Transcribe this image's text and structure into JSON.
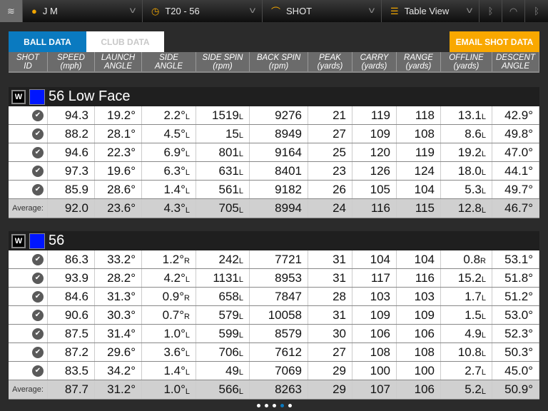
{
  "topbar": {
    "player": "J M",
    "session": "T20 - 56",
    "mode": "SHOT",
    "view": "Table View",
    "icons": [
      "logo-icon",
      "person-icon",
      "clock-icon",
      "shot-arc-icon",
      "list-icon",
      "bluetooth-icon",
      "wifi-icon",
      "bluetooth-signal-icon"
    ]
  },
  "tabs": {
    "ball": "BALL DATA",
    "club": "CLUB DATA"
  },
  "email": "EMAIL SHOT DATA",
  "columns": [
    [
      "SHOT",
      "ID"
    ],
    [
      "SPEED",
      "(mph)"
    ],
    [
      "LAUNCH",
      "ANGLE"
    ],
    [
      "SIDE",
      "ANGLE"
    ],
    [
      "SIDE SPIN",
      "(rpm)"
    ],
    [
      "BACK SPIN",
      "(rpm)"
    ],
    [
      "PEAK",
      "(yards)"
    ],
    [
      "CARRY",
      "(yards)"
    ],
    [
      "RANGE",
      "(yards)"
    ],
    [
      "OFFLINE",
      "(yards)"
    ],
    [
      "DESCENT",
      "ANGLE"
    ]
  ],
  "average_label": "Average:",
  "colors": {
    "accent": "#0a7ac0",
    "email": "#f9a800",
    "club_color": "#0016ff"
  },
  "groups": [
    {
      "badge": "W",
      "name": "56 Low Face",
      "rows": [
        [
          [
            "94.3",
            ""
          ],
          [
            "19.2°",
            ""
          ],
          [
            "2.2°",
            "L"
          ],
          [
            "1519",
            "L"
          ],
          [
            "9276",
            ""
          ],
          [
            "21",
            ""
          ],
          [
            "119",
            ""
          ],
          [
            "118",
            ""
          ],
          [
            "13.1",
            "L"
          ],
          [
            "42.9°",
            ""
          ]
        ],
        [
          [
            "88.2",
            ""
          ],
          [
            "28.1°",
            ""
          ],
          [
            "4.5°",
            "L"
          ],
          [
            "15",
            "L"
          ],
          [
            "8949",
            ""
          ],
          [
            "27",
            ""
          ],
          [
            "109",
            ""
          ],
          [
            "108",
            ""
          ],
          [
            "8.6",
            "L"
          ],
          [
            "49.8°",
            ""
          ]
        ],
        [
          [
            "94.6",
            ""
          ],
          [
            "22.3°",
            ""
          ],
          [
            "6.9°",
            "L"
          ],
          [
            "801",
            "L"
          ],
          [
            "9164",
            ""
          ],
          [
            "25",
            ""
          ],
          [
            "120",
            ""
          ],
          [
            "119",
            ""
          ],
          [
            "19.2",
            "L"
          ],
          [
            "47.0°",
            ""
          ]
        ],
        [
          [
            "97.3",
            ""
          ],
          [
            "19.6°",
            ""
          ],
          [
            "6.3°",
            "L"
          ],
          [
            "631",
            "L"
          ],
          [
            "8401",
            ""
          ],
          [
            "23",
            ""
          ],
          [
            "126",
            ""
          ],
          [
            "124",
            ""
          ],
          [
            "18.0",
            "L"
          ],
          [
            "44.1°",
            ""
          ]
        ],
        [
          [
            "85.9",
            ""
          ],
          [
            "28.6°",
            ""
          ],
          [
            "1.4°",
            "L"
          ],
          [
            "561",
            "L"
          ],
          [
            "9182",
            ""
          ],
          [
            "26",
            ""
          ],
          [
            "105",
            ""
          ],
          [
            "104",
            ""
          ],
          [
            "5.3",
            "L"
          ],
          [
            "49.7°",
            ""
          ]
        ]
      ],
      "average": [
        [
          "92.0",
          ""
        ],
        [
          "23.6°",
          ""
        ],
        [
          "4.3°",
          "L"
        ],
        [
          "705",
          "L"
        ],
        [
          "8994",
          ""
        ],
        [
          "24",
          ""
        ],
        [
          "116",
          ""
        ],
        [
          "115",
          ""
        ],
        [
          "12.8",
          "L"
        ],
        [
          "46.7°",
          ""
        ]
      ]
    },
    {
      "badge": "W",
      "name": "56",
      "rows": [
        [
          [
            "86.3",
            ""
          ],
          [
            "33.2°",
            ""
          ],
          [
            "1.2°",
            "R"
          ],
          [
            "242",
            "L"
          ],
          [
            "7721",
            ""
          ],
          [
            "31",
            ""
          ],
          [
            "104",
            ""
          ],
          [
            "104",
            ""
          ],
          [
            "0.8",
            "R"
          ],
          [
            "53.1°",
            ""
          ]
        ],
        [
          [
            "93.9",
            ""
          ],
          [
            "28.2°",
            ""
          ],
          [
            "4.2°",
            "L"
          ],
          [
            "1131",
            "L"
          ],
          [
            "8953",
            ""
          ],
          [
            "31",
            ""
          ],
          [
            "117",
            ""
          ],
          [
            "116",
            ""
          ],
          [
            "15.2",
            "L"
          ],
          [
            "51.8°",
            ""
          ]
        ],
        [
          [
            "84.6",
            ""
          ],
          [
            "31.3°",
            ""
          ],
          [
            "0.9°",
            "R"
          ],
          [
            "658",
            "L"
          ],
          [
            "7847",
            ""
          ],
          [
            "28",
            ""
          ],
          [
            "103",
            ""
          ],
          [
            "103",
            ""
          ],
          [
            "1.7",
            "L"
          ],
          [
            "51.2°",
            ""
          ]
        ],
        [
          [
            "90.6",
            ""
          ],
          [
            "30.3°",
            ""
          ],
          [
            "0.7°",
            "R"
          ],
          [
            "579",
            "L"
          ],
          [
            "10058",
            ""
          ],
          [
            "31",
            ""
          ],
          [
            "109",
            ""
          ],
          [
            "109",
            ""
          ],
          [
            "1.5",
            "L"
          ],
          [
            "53.0°",
            ""
          ]
        ],
        [
          [
            "87.5",
            ""
          ],
          [
            "31.4°",
            ""
          ],
          [
            "1.0°",
            "L"
          ],
          [
            "599",
            "L"
          ],
          [
            "8579",
            ""
          ],
          [
            "30",
            ""
          ],
          [
            "106",
            ""
          ],
          [
            "106",
            ""
          ],
          [
            "4.9",
            "L"
          ],
          [
            "52.3°",
            ""
          ]
        ],
        [
          [
            "87.2",
            ""
          ],
          [
            "29.6°",
            ""
          ],
          [
            "3.6°",
            "L"
          ],
          [
            "706",
            "L"
          ],
          [
            "7612",
            ""
          ],
          [
            "27",
            ""
          ],
          [
            "108",
            ""
          ],
          [
            "108",
            ""
          ],
          [
            "10.8",
            "L"
          ],
          [
            "50.3°",
            ""
          ]
        ],
        [
          [
            "83.5",
            ""
          ],
          [
            "34.2°",
            ""
          ],
          [
            "1.4°",
            "L"
          ],
          [
            "49",
            "L"
          ],
          [
            "7069",
            ""
          ],
          [
            "29",
            ""
          ],
          [
            "100",
            ""
          ],
          [
            "100",
            ""
          ],
          [
            "2.7",
            "L"
          ],
          [
            "45.0°",
            ""
          ]
        ]
      ],
      "average": [
        [
          "87.7",
          ""
        ],
        [
          "31.2°",
          ""
        ],
        [
          "1.0°",
          "L"
        ],
        [
          "566",
          "L"
        ],
        [
          "8263",
          ""
        ],
        [
          "29",
          ""
        ],
        [
          "107",
          ""
        ],
        [
          "106",
          ""
        ],
        [
          "5.2",
          "L"
        ],
        [
          "50.9°",
          ""
        ]
      ]
    }
  ],
  "pager": {
    "pages": 5,
    "current": 4
  }
}
